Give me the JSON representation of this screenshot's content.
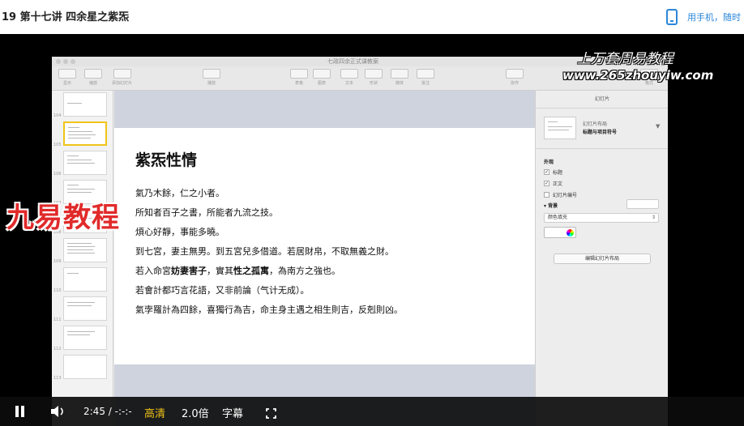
{
  "page": {
    "title": "19 第十七讲 四余星之紫炁",
    "mobile_link": "用手机，随时"
  },
  "keynote": {
    "doc_title": "七政四余正式课教案",
    "toolbar": [
      "显示",
      "缩放",
      "添加幻灯片",
      "播放",
      "表格",
      "图表",
      "文本",
      "形状",
      "媒体",
      "批注",
      "协作",
      "格式"
    ],
    "slide_numbers": [
      "104",
      "105",
      "106",
      "107",
      "108",
      "109",
      "110",
      "111",
      "112",
      "113"
    ],
    "slide": {
      "title": "紫炁性情",
      "lines": [
        "氣乃木餘，仁之小者。",
        "所知者百子之書，所能者九流之技。",
        "煩心好靜，事能多曉。",
        "到七宮，妻主無男。到五宮兒多借道。若居財帛，不取無義之財。",
        {
          "pre": "若入命宮",
          "bold1": "妨妻害子",
          "mid": "，實其",
          "bold2": "性之孤寓",
          "post": "，為南方之強也。"
        },
        "若會計都巧言花語，又非前論（气计无成）。",
        "氣孛羅計為四餘，喜獨行為吉，命主身主遇之相生則吉，反剋則凶。"
      ]
    },
    "inspector": {
      "header": "幻灯片",
      "layout_title": "幻灯片布局",
      "layout_name": "标题与项目符号",
      "appearance": "外观",
      "checkboxes": [
        {
          "label": "标题",
          "checked": "✓"
        },
        {
          "label": "正文",
          "checked": "✓"
        },
        {
          "label": "幻灯片编号",
          "checked": ""
        }
      ],
      "background_label": "背景",
      "fill_option": "颜色填充",
      "edit_layout": "编辑幻灯片布局"
    }
  },
  "watermarks": {
    "top_text": "上万套周易教程",
    "url": "www.265zhouyiw.com",
    "left_logo": "九易教程"
  },
  "player": {
    "time": "2:45 / -:-:-",
    "quality": "高清",
    "speed": "2.0倍",
    "subtitle": "字幕"
  },
  "colors": {
    "accent_blue": "#2a86d8",
    "quality_yellow": "#f0c419",
    "watermark_red": "#e12a2a",
    "selected_thumb": "#f0c419"
  }
}
